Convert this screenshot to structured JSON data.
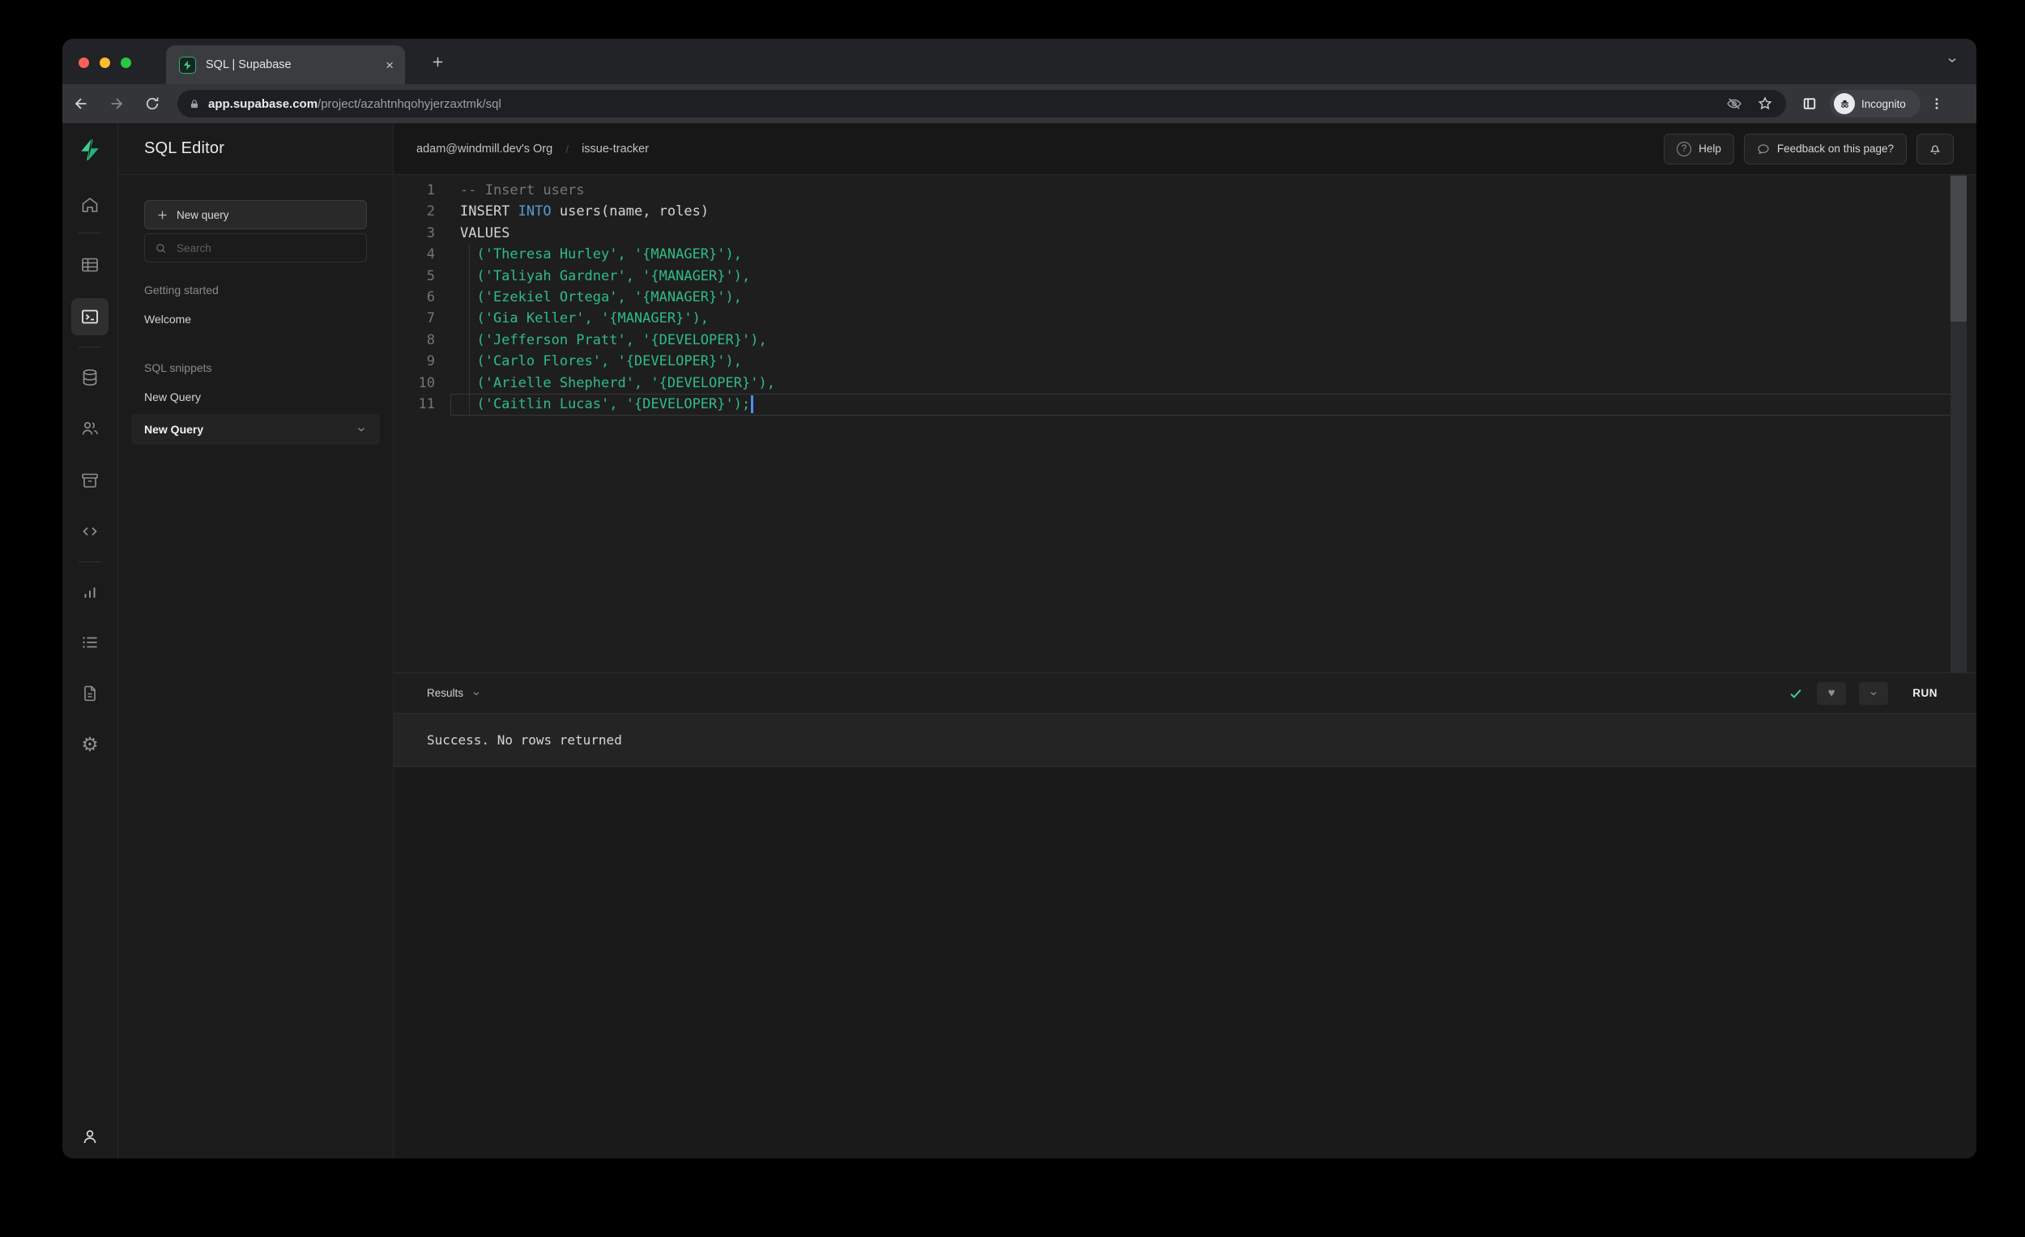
{
  "browser": {
    "tab_title": "SQL | Supabase",
    "url_host": "app.supabase.com",
    "url_path": "/project/azahtnhqohyjerzaxtmk/sql",
    "incognito_label": "Incognito"
  },
  "window": {
    "traffic_lights": {
      "close": "#ff5f57",
      "minimize": "#febc2e",
      "zoom": "#28c840"
    }
  },
  "rail": {
    "icons": [
      "supabase-logo",
      "home",
      "table-editor",
      "sql-editor",
      "database",
      "authentication",
      "storage",
      "edge-functions",
      "reports",
      "logs",
      "api-docs",
      "settings",
      "account"
    ],
    "active": "sql-editor"
  },
  "sidebar": {
    "title": "SQL Editor",
    "new_query_button": "New query",
    "search_placeholder": "Search",
    "section_getting_started": "Getting started",
    "item_welcome": "Welcome",
    "section_snippets": "SQL snippets",
    "item_new_query": "New Query",
    "selected_query": "New Query"
  },
  "header": {
    "breadcrumb_org": "adam@windmill.dev's Org",
    "breadcrumb_project": "issue-tracker",
    "help_label": "Help",
    "feedback_label": "Feedback on this page?"
  },
  "editor": {
    "lines": [
      {
        "num": "1",
        "comment": "-- Insert users"
      },
      {
        "num": "2",
        "pre": "INSERT ",
        "keyword": "INTO",
        "post": " users(name, roles)"
      },
      {
        "num": "3",
        "plain": "VALUES"
      },
      {
        "num": "4",
        "string": "  ('Theresa Hurley', '{MANAGER}'),"
      },
      {
        "num": "5",
        "string": "  ('Taliyah Gardner', '{MANAGER}'),"
      },
      {
        "num": "6",
        "string": "  ('Ezekiel Ortega', '{MANAGER}'),"
      },
      {
        "num": "7",
        "string": "  ('Gia Keller', '{MANAGER}'),"
      },
      {
        "num": "8",
        "string": "  ('Jefferson Pratt', '{DEVELOPER}'),"
      },
      {
        "num": "9",
        "string": "  ('Carlo Flores', '{DEVELOPER}'),"
      },
      {
        "num": "10",
        "string": "  ('Arielle Shepherd', '{DEVELOPER}'),"
      },
      {
        "num": "11",
        "string": "  ('Caitlin Lucas', '{DEVELOPER}');"
      }
    ]
  },
  "results": {
    "label": "Results",
    "run_label": "RUN",
    "message": "Success. No rows returned"
  },
  "colors": {
    "accent_green": "#3ecf8e",
    "keyword_blue": "#569cd6",
    "string_green": "#2ebd85",
    "comment_gray": "#767676",
    "cursor_blue": "#4e8df6"
  }
}
